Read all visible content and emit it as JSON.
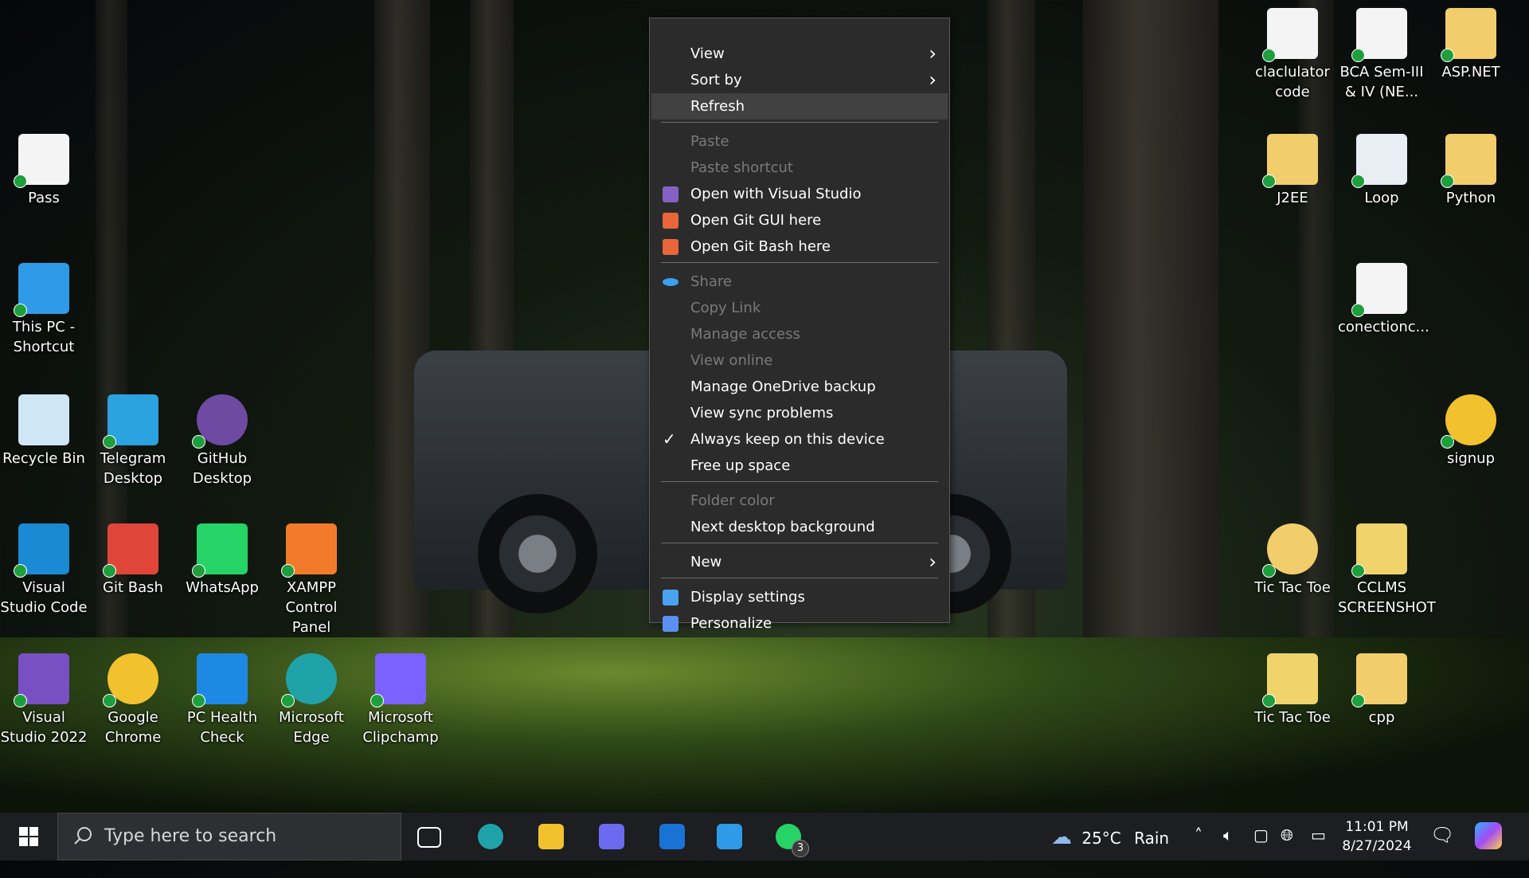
{
  "desktop_icons": [
    {
      "label": "Pass",
      "icon": "pdf-document-icon"
    },
    {
      "label": "This PC - Shortcut",
      "icon": "computer-icon"
    },
    {
      "label": "Recycle Bin",
      "icon": "recycle-bin-icon"
    },
    {
      "label": "Telegram Desktop",
      "icon": "telegram-icon"
    },
    {
      "label": "GitHub Desktop",
      "icon": "github-icon"
    },
    {
      "label": "Visual Studio Code",
      "icon": "vscode-icon"
    },
    {
      "label": "Git Bash",
      "icon": "git-bash-icon"
    },
    {
      "label": "WhatsApp",
      "icon": "whatsapp-icon"
    },
    {
      "label": "XAMPP Control Panel",
      "icon": "xampp-icon"
    },
    {
      "label": "Visual Studio 2022",
      "icon": "visual-studio-icon"
    },
    {
      "label": "Google Chrome",
      "icon": "chrome-icon"
    },
    {
      "label": "PC Health Check",
      "icon": "health-check-icon"
    },
    {
      "label": "Microsoft Edge",
      "icon": "edge-icon"
    },
    {
      "label": "Microsoft Clipchamp",
      "icon": "clipchamp-icon"
    },
    {
      "label": "claclulator code",
      "icon": "text-document-icon"
    },
    {
      "label": "BCA Sem-III & IV (NE...",
      "icon": "pdf-document-icon"
    },
    {
      "label": "ASP.NET",
      "icon": "pdf-folder-icon"
    },
    {
      "label": "J2EE",
      "icon": "pdf-folder-icon"
    },
    {
      "label": "Loop",
      "icon": "spreadsheet-document-icon"
    },
    {
      "label": "Python",
      "icon": "folder-icon"
    },
    {
      "label": "conectionc...",
      "icon": "text-document-icon"
    },
    {
      "label": "signup",
      "icon": "chrome-icon"
    },
    {
      "label": "Tic Tac Toe",
      "icon": "chrome-folder-icon"
    },
    {
      "label": "CCLMS SCREENSHOT",
      "icon": "zip-folder-icon"
    },
    {
      "label": "Tic Tac Toe",
      "icon": "zip-folder-icon"
    },
    {
      "label": "cpp",
      "icon": "folder-icon"
    }
  ],
  "context_menu": {
    "items": [
      {
        "label": "View",
        "state": "enabled",
        "submenu": true
      },
      {
        "label": "Sort by",
        "state": "enabled",
        "submenu": true
      },
      {
        "label": "Refresh",
        "state": "hover"
      },
      {
        "label": "Paste",
        "state": "disabled"
      },
      {
        "label": "Paste shortcut",
        "state": "disabled"
      },
      {
        "label": "Open with Visual Studio",
        "state": "enabled",
        "icon": "visual-studio-icon"
      },
      {
        "label": "Open Git GUI here",
        "state": "enabled",
        "icon": "git-icon"
      },
      {
        "label": "Open Git Bash here",
        "state": "enabled",
        "icon": "git-icon"
      },
      {
        "label": "Share",
        "state": "disabled",
        "icon": "onedrive-icon"
      },
      {
        "label": "Copy Link",
        "state": "disabled"
      },
      {
        "label": "Manage access",
        "state": "disabled"
      },
      {
        "label": "View online",
        "state": "disabled"
      },
      {
        "label": "Manage OneDrive backup",
        "state": "enabled"
      },
      {
        "label": "View sync problems",
        "state": "enabled"
      },
      {
        "label": "Always keep on this device",
        "state": "enabled",
        "icon": "checkmark-icon"
      },
      {
        "label": "Free up space",
        "state": "enabled"
      },
      {
        "label": "Folder color",
        "state": "disabled"
      },
      {
        "label": "Next desktop background",
        "state": "enabled"
      },
      {
        "label": "New",
        "state": "enabled",
        "submenu": true
      },
      {
        "label": "Display settings",
        "state": "enabled",
        "icon": "display-settings-icon"
      },
      {
        "label": "Personalize",
        "state": "enabled",
        "icon": "personalize-icon"
      }
    ]
  },
  "taskbar": {
    "search_placeholder": "Type here to search",
    "pinned": [
      {
        "name": "task-view-icon"
      },
      {
        "name": "edge-icon"
      },
      {
        "name": "file-explorer-icon"
      },
      {
        "name": "copilot-icon"
      },
      {
        "name": "outlook-icon"
      },
      {
        "name": "microsoft-store-icon"
      },
      {
        "name": "whatsapp-icon",
        "badge": "3"
      }
    ],
    "weather": {
      "temp": "25°C",
      "condition": "Rain"
    },
    "clock": {
      "time": "11:01 PM",
      "date": "8/27/2024"
    }
  },
  "colors": {
    "menu_bg": "#2b2b2b",
    "taskbar_bg": "#1c1e22",
    "sync_check": "#1e9f3d"
  }
}
